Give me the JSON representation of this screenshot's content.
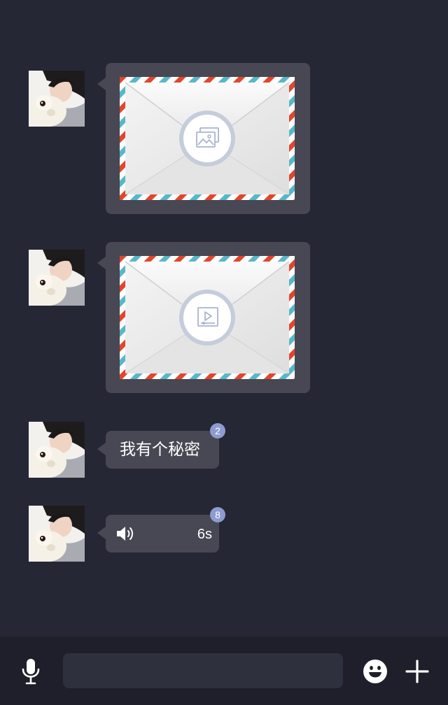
{
  "colors": {
    "background": "#262734",
    "bubble": "#474853",
    "badge": "#8c9cd0",
    "bottom_bar": "#1e1f2a",
    "input": "#2f303d"
  },
  "messages": [
    {
      "type": "image",
      "icon": "image-icon"
    },
    {
      "type": "video",
      "icon": "video-play-icon"
    },
    {
      "type": "text",
      "text": "我有个秘密",
      "badge": "2"
    },
    {
      "type": "voice",
      "icon": "speaker-icon",
      "duration": "6s",
      "badge": "8"
    }
  ],
  "input_bar": {
    "mic_icon": "microphone-icon",
    "input_value": "",
    "input_placeholder": "",
    "emoji_icon": "emoji-icon",
    "plus_icon": "plus-icon"
  }
}
